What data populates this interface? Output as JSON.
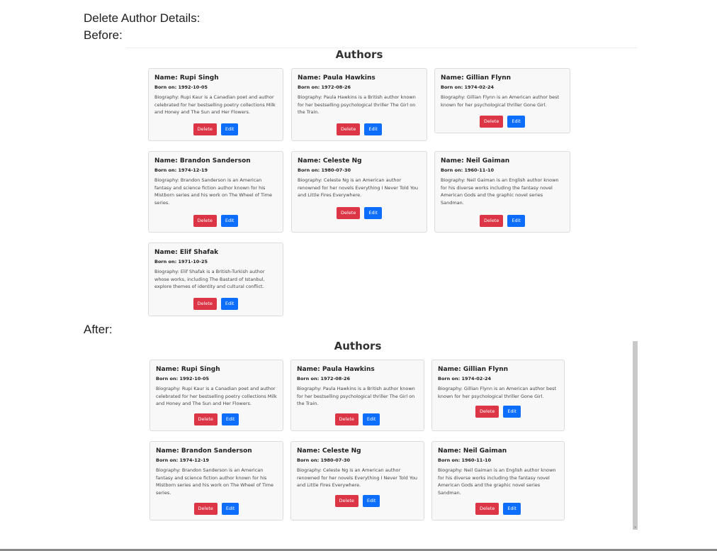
{
  "doc": {
    "heading": "Delete Author Details:",
    "before_label": "Before:",
    "after_label": "After:"
  },
  "section_title": "Authors",
  "labels": {
    "name_prefix": "Name: ",
    "born_prefix": "Born on: ",
    "bio_prefix": "Biography: "
  },
  "buttons": {
    "delete": "Delete",
    "edit": "Edit"
  },
  "before_authors": [
    {
      "name": "Rupi Singh",
      "born": "1992-10-05",
      "bio": "Rupi Kaur is a Canadian poet and author celebrated for her bestselling poetry collections Milk and Honey and The Sun and Her Flowers."
    },
    {
      "name": "Paula Hawkins",
      "born": "1972-08-26",
      "bio": "Paula Hawkins is a British author known for her bestselling psychological thriller The Girl on the Train."
    },
    {
      "name": "Gillian Flynn",
      "born": "1974-02-24",
      "bio": "Gillian Flynn is an American author best known for her psychological thriller Gone Girl."
    },
    {
      "name": "Brandon Sanderson",
      "born": "1974-12-19",
      "bio": "Brandon Sanderson is an American fantasy and science fiction author known for his Mistborn series and his work on The Wheel of Time series."
    },
    {
      "name": "Celeste Ng",
      "born": "1980-07-30",
      "bio": "Celeste Ng is an American author renowned for her novels Everything I Never Told You and Little Fires Everywhere."
    },
    {
      "name": "Neil Gaiman",
      "born": "1960-11-10",
      "bio": "Neil Gaiman is an English author known for his diverse works including the fantasy novel American Gods and the graphic novel series Sandman."
    },
    {
      "name": "Elif Shafak",
      "born": "1971-10-25",
      "bio": "Elif Shafak is a British-Turkish author whose works, including The Bastard of Istanbul, explore themes of identity and cultural conflict."
    }
  ],
  "after_authors": [
    {
      "name": "Rupi Singh",
      "born": "1992-10-05",
      "bio": "Rupi Kaur is a Canadian poet and author celebrated for her bestselling poetry collections Milk and Honey and The Sun and Her Flowers."
    },
    {
      "name": "Paula Hawkins",
      "born": "1972-08-26",
      "bio": "Paula Hawkins is a British author known for her bestselling psychological thriller The Girl on the Train."
    },
    {
      "name": "Gillian Flynn",
      "born": "1974-02-24",
      "bio": "Gillian Flynn is an American author best known for her psychological thriller Gone Girl."
    },
    {
      "name": "Brandon Sanderson",
      "born": "1974-12-19",
      "bio": "Brandon Sanderson is an American fantasy and science fiction author known for his Mistborn series and his work on The Wheel of Time series."
    },
    {
      "name": "Celeste Ng",
      "born": "1980-07-30",
      "bio": "Celeste Ng is an American author renowned for her novels Everything I Never Told You and Little Fires Everywhere."
    },
    {
      "name": "Neil Gaiman",
      "born": "1960-11-10",
      "bio": "Neil Gaiman is an English author known for his diverse works including the fantasy novel American Gods and the graphic novel series Sandman."
    }
  ],
  "colors": {
    "delete": "#dc3545",
    "edit": "#0d6efd",
    "card_bg": "#f8f8f8"
  }
}
